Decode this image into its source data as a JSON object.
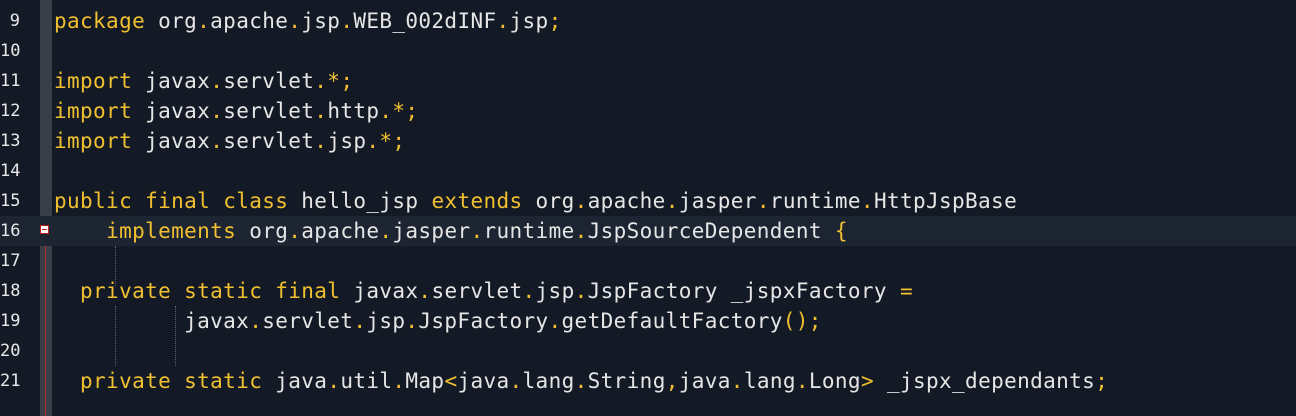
{
  "editor": {
    "lines": [
      {
        "num": "9",
        "parts": [
          {
            "t": "package",
            "k": "kw"
          },
          {
            "t": " org"
          },
          {
            "t": ".",
            "k": "pn"
          },
          {
            "t": "apache"
          },
          {
            "t": ".",
            "k": "pn"
          },
          {
            "t": "jsp"
          },
          {
            "t": ".",
            "k": "pn"
          },
          {
            "t": "WEB_002dINF"
          },
          {
            "t": ".",
            "k": "pn"
          },
          {
            "t": "jsp"
          },
          {
            "t": ";",
            "k": "pn"
          }
        ]
      },
      {
        "num": "10",
        "parts": []
      },
      {
        "num": "11",
        "parts": [
          {
            "t": "import",
            "k": "kw"
          },
          {
            "t": " javax"
          },
          {
            "t": ".",
            "k": "pn"
          },
          {
            "t": "servlet"
          },
          {
            "t": ".*;",
            "k": "pn"
          }
        ]
      },
      {
        "num": "12",
        "parts": [
          {
            "t": "import",
            "k": "kw"
          },
          {
            "t": " javax"
          },
          {
            "t": ".",
            "k": "pn"
          },
          {
            "t": "servlet"
          },
          {
            "t": ".",
            "k": "pn"
          },
          {
            "t": "http"
          },
          {
            "t": ".*;",
            "k": "pn"
          }
        ]
      },
      {
        "num": "13",
        "parts": [
          {
            "t": "import",
            "k": "kw"
          },
          {
            "t": " javax"
          },
          {
            "t": ".",
            "k": "pn"
          },
          {
            "t": "servlet"
          },
          {
            "t": ".",
            "k": "pn"
          },
          {
            "t": "jsp"
          },
          {
            "t": ".*;",
            "k": "pn"
          }
        ]
      },
      {
        "num": "14",
        "parts": []
      },
      {
        "num": "15",
        "parts": [
          {
            "t": "public",
            "k": "kw"
          },
          {
            "t": " "
          },
          {
            "t": "final",
            "k": "kw"
          },
          {
            "t": " "
          },
          {
            "t": "class",
            "k": "kw"
          },
          {
            "t": " hello_jsp "
          },
          {
            "t": "extends",
            "k": "kw"
          },
          {
            "t": " org"
          },
          {
            "t": ".",
            "k": "pn"
          },
          {
            "t": "apache"
          },
          {
            "t": ".",
            "k": "pn"
          },
          {
            "t": "jasper"
          },
          {
            "t": ".",
            "k": "pn"
          },
          {
            "t": "runtime"
          },
          {
            "t": ".",
            "k": "pn"
          },
          {
            "t": "HttpJspBase"
          }
        ]
      },
      {
        "num": "16",
        "current": true,
        "parts": [
          {
            "t": "    "
          },
          {
            "t": "implements",
            "k": "kw"
          },
          {
            "t": " org"
          },
          {
            "t": ".",
            "k": "pn"
          },
          {
            "t": "apache"
          },
          {
            "t": ".",
            "k": "pn"
          },
          {
            "t": "jasper"
          },
          {
            "t": ".",
            "k": "pn"
          },
          {
            "t": "runtime"
          },
          {
            "t": ".",
            "k": "pn"
          },
          {
            "t": "JspSourceDependent "
          },
          {
            "t": "{",
            "k": "pn"
          }
        ]
      },
      {
        "num": "17",
        "parts": []
      },
      {
        "num": "18",
        "parts": [
          {
            "t": "  "
          },
          {
            "t": "private",
            "k": "kw"
          },
          {
            "t": " "
          },
          {
            "t": "static",
            "k": "kw"
          },
          {
            "t": " "
          },
          {
            "t": "final",
            "k": "kw"
          },
          {
            "t": " javax"
          },
          {
            "t": ".",
            "k": "pn"
          },
          {
            "t": "servlet"
          },
          {
            "t": ".",
            "k": "pn"
          },
          {
            "t": "jsp"
          },
          {
            "t": ".",
            "k": "pn"
          },
          {
            "t": "JspFactory _jspxFactory "
          },
          {
            "t": "=",
            "k": "pn"
          }
        ]
      },
      {
        "num": "19",
        "parts": [
          {
            "t": "          javax"
          },
          {
            "t": ".",
            "k": "pn"
          },
          {
            "t": "servlet"
          },
          {
            "t": ".",
            "k": "pn"
          },
          {
            "t": "jsp"
          },
          {
            "t": ".",
            "k": "pn"
          },
          {
            "t": "JspFactory"
          },
          {
            "t": ".",
            "k": "pn"
          },
          {
            "t": "getDefaultFactory"
          },
          {
            "t": "();",
            "k": "pn"
          }
        ]
      },
      {
        "num": "20",
        "parts": []
      },
      {
        "num": "21",
        "parts": [
          {
            "t": "  "
          },
          {
            "t": "private",
            "k": "kw"
          },
          {
            "t": " "
          },
          {
            "t": "static",
            "k": "kw"
          },
          {
            "t": " java"
          },
          {
            "t": ".",
            "k": "pn"
          },
          {
            "t": "util"
          },
          {
            "t": ".",
            "k": "pn"
          },
          {
            "t": "Map"
          },
          {
            "t": "<",
            "k": "pn"
          },
          {
            "t": "java"
          },
          {
            "t": ".",
            "k": "pn"
          },
          {
            "t": "lang"
          },
          {
            "t": ".",
            "k": "pn"
          },
          {
            "t": "String"
          },
          {
            "t": ",",
            "k": "pn"
          },
          {
            "t": "java"
          },
          {
            "t": ".",
            "k": "pn"
          },
          {
            "t": "lang"
          },
          {
            "t": ".",
            "k": "pn"
          },
          {
            "t": "Long"
          },
          {
            "t": ">",
            "k": "pn"
          },
          {
            "t": " _jspx_dependants"
          },
          {
            "t": ";",
            "k": "pn"
          }
        ]
      }
    ]
  }
}
